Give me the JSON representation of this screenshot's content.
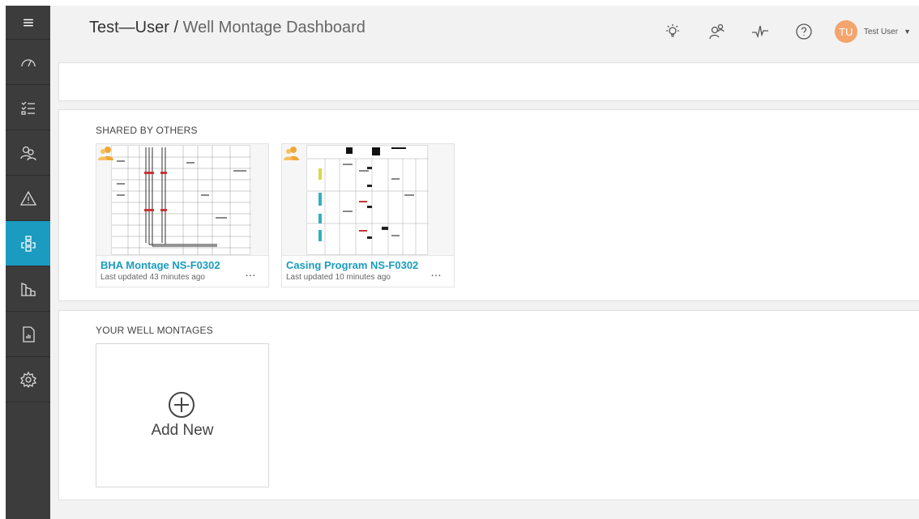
{
  "header": {
    "org": "Test—User",
    "separator": "/",
    "page_title": "Well Montage Dashboard",
    "user_initials": "TU",
    "user_name": "Test User",
    "avatar_color": "#f4a46d"
  },
  "sidebar": {
    "active_color": "#1a9bbf",
    "items": [
      {
        "icon": "menu-icon"
      },
      {
        "icon": "dashboard-gauge-icon"
      },
      {
        "icon": "checklist-icon"
      },
      {
        "icon": "users-icon"
      },
      {
        "icon": "warning-icon"
      },
      {
        "icon": "well-montage-icon",
        "active": true
      },
      {
        "icon": "buildings-icon"
      },
      {
        "icon": "report-icon"
      },
      {
        "icon": "settings-icon"
      }
    ]
  },
  "top_icons": [
    "lightbulb-icon",
    "user-share-icon",
    "activity-icon",
    "help-icon"
  ],
  "shared": {
    "title": "SHARED BY OTHERS",
    "cards": [
      {
        "title": "BHA Montage NS-F0302",
        "updated": "Last updated 43 minutes ago",
        "more": "…"
      },
      {
        "title": "Casing Program NS-F0302",
        "updated": "Last updated 10 minutes ago",
        "more": "…"
      }
    ]
  },
  "yours": {
    "title": "YOUR WELL MONTAGES",
    "add_label": "Add New"
  }
}
